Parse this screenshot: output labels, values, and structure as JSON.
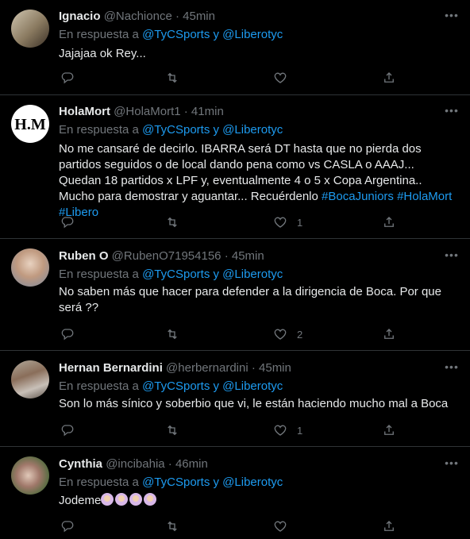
{
  "tweets": [
    {
      "name": "Ignacio",
      "handle": "@Nachionce",
      "time": "· 45min",
      "reply_prefix": "En respuesta a ",
      "reply_a": "@TyCSports",
      "reply_and": " y ",
      "reply_b": "@Liberotyc",
      "text": "Jajajaa ok Rey...",
      "like_count": "",
      "retweet_count": "",
      "reply_count": ""
    },
    {
      "name": "HolaMort",
      "handle": "@HolaMort1",
      "time": "· 41min",
      "reply_prefix": "En respuesta a ",
      "reply_a": "@TyCSports",
      "reply_and": " y ",
      "reply_b": "@Liberotyc",
      "text": "No me cansaré de decirlo. IBARRA será DT hasta que no pierda dos partidos seguidos o de local dando pena como vs CASLA o AAAJ... Quedan 18 partidos x LPF y, eventualmente 4 o 5 x Copa Argentina.. Mucho para demostrar y aguantar... Recuérdenlo ",
      "hashtags": [
        "#BocaJuniors",
        "#HolaMort",
        "#Libero"
      ],
      "like_count": "1",
      "avatar_text": "H.M"
    },
    {
      "name": "Ruben O",
      "handle": "@RubenO71954156",
      "time": "· 45min",
      "reply_prefix": "En respuesta a ",
      "reply_a": "@TyCSports",
      "reply_and": " y ",
      "reply_b": "@Liberotyc",
      "text": "No saben más que hacer para defender a la dirigencia de Boca. Por que será ??",
      "like_count": "2"
    },
    {
      "name": "Hernan Bernardini",
      "handle": "@herbernardini",
      "time": "· 45min",
      "reply_prefix": "En respuesta a ",
      "reply_a": "@TyCSports",
      "reply_and": " y ",
      "reply_b": "@Liberotyc",
      "text": "Son lo más sínico y soberbio que vi, le están haciendo mucho mal a Boca",
      "like_count": "1"
    },
    {
      "name": "Cynthia",
      "handle": "@incibahia",
      "time": "· 46min",
      "reply_prefix": "En respuesta a ",
      "reply_a": "@TyCSports",
      "reply_and": " y ",
      "reply_b": "@Liberotyc",
      "text": "Jodeme",
      "emoji_count": 4,
      "like_count": ""
    }
  ],
  "colors": {
    "background": "#000000",
    "link": "#1d9bf0",
    "muted": "#71767b",
    "divider": "#2f3336"
  },
  "icons": {
    "reply": "reply-icon",
    "retweet": "retweet-icon",
    "like": "heart-icon",
    "share": "share-icon",
    "more": "more-icon"
  }
}
